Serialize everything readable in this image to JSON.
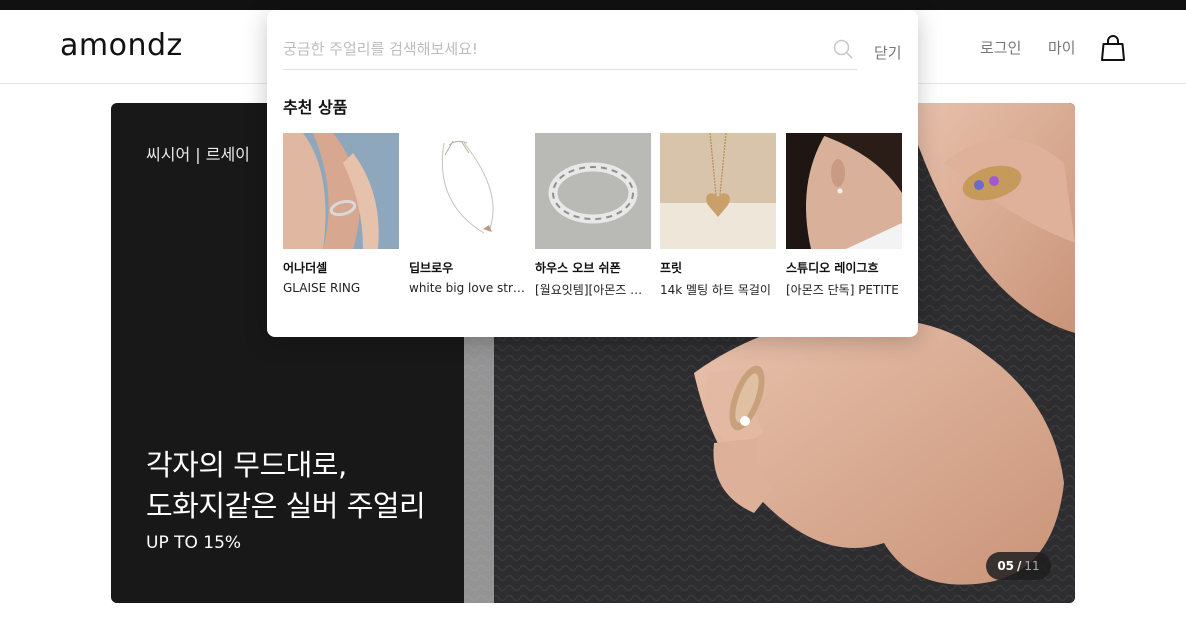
{
  "header": {
    "logo": "amondz",
    "login": "로그인",
    "my": "마이",
    "cart_icon": "shopping-bag-icon"
  },
  "search": {
    "placeholder": "궁금한 주얼리를 검색해보세요!",
    "close_label": "닫기",
    "search_icon": "search-icon"
  },
  "recommended": {
    "title": "추천 상품",
    "products": [
      {
        "brand": "어나더셀",
        "name": "GLAISE RING"
      },
      {
        "brand": "딥브로우",
        "name": "white big love strap necklace"
      },
      {
        "brand": "하우스 오브 쉬폰",
        "name": "[월요잇템][아몬즈 단독]"
      },
      {
        "brand": "프릿",
        "name": "14k 멜팅 하트 목걸이"
      },
      {
        "brand": "스튜디오 레이그흐",
        "name": "[아몬즈 단독] PETITE"
      }
    ]
  },
  "banner": {
    "brand": "씨시어 | 르세이",
    "headline_line1": "각자의 무드대로,",
    "headline_line2": "도화지같은 실버 주얼리",
    "discount": "UP TO 15%",
    "counter_current": "05",
    "counter_separator": "/",
    "counter_total": "11"
  },
  "colors": {
    "topbar": "#111111",
    "banner_bg": "#181818",
    "muted_text": "#777777"
  }
}
